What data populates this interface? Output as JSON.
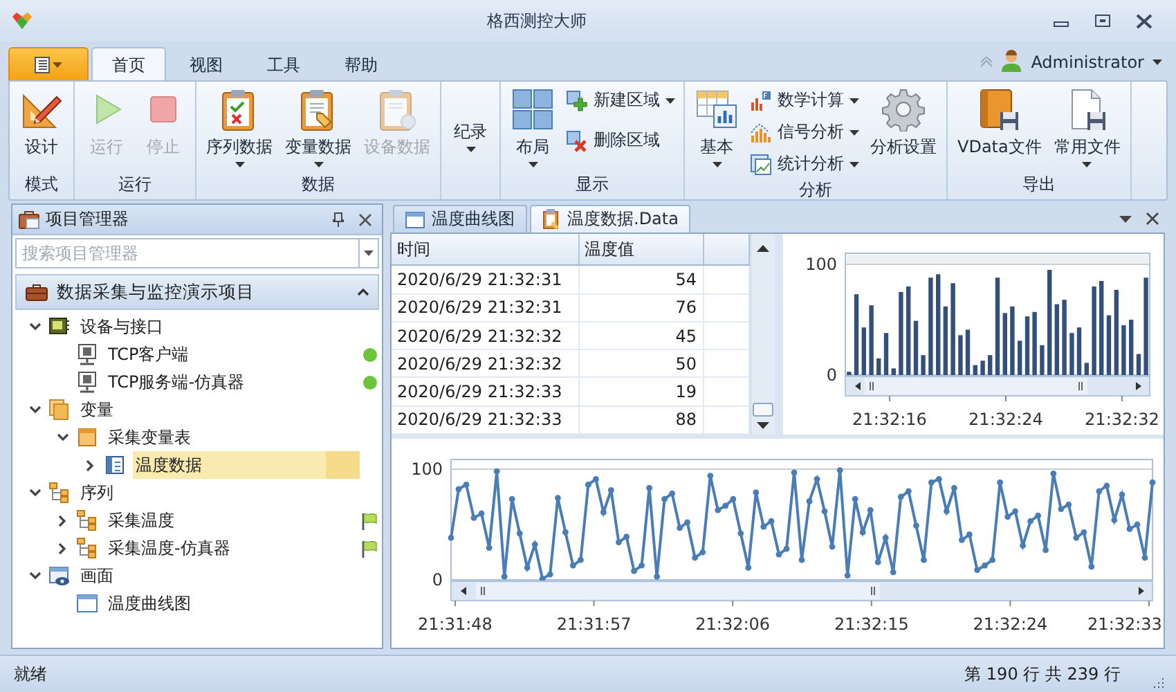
{
  "window": {
    "title": "格西测控大师"
  },
  "ribbon": {
    "tabs": [
      {
        "label": "首页",
        "selected": true
      },
      {
        "label": "视图",
        "selected": false
      },
      {
        "label": "工具",
        "selected": false
      },
      {
        "label": "帮助",
        "selected": false
      }
    ],
    "user": "Administrator",
    "groups": [
      {
        "label": "模式",
        "items": [
          {
            "label": "设计",
            "kind": "large",
            "disabled": false,
            "dropdown": false
          }
        ]
      },
      {
        "label": "运行",
        "items": [
          {
            "label": "运行",
            "kind": "large",
            "disabled": true,
            "dropdown": false
          },
          {
            "label": "停止",
            "kind": "large",
            "disabled": true,
            "dropdown": false
          }
        ]
      },
      {
        "label": "数据",
        "items": [
          {
            "label": "序列数据",
            "kind": "large",
            "disabled": false,
            "dropdown": true
          },
          {
            "label": "变量数据",
            "kind": "large",
            "disabled": false,
            "dropdown": true
          },
          {
            "label": "设备数据",
            "kind": "large",
            "disabled": true,
            "dropdown": false
          }
        ]
      },
      {
        "items": [
          {
            "label": "纪录",
            "kind": "large",
            "disabled": false,
            "dropdown": true
          }
        ]
      },
      {
        "label": "显示",
        "items": [
          {
            "label": "布局",
            "kind": "large",
            "disabled": false,
            "dropdown": true
          },
          {
            "label": "新建区域",
            "kind": "small",
            "disabled": false,
            "dropdown": true
          },
          {
            "label": "删除区域",
            "kind": "small",
            "disabled": false,
            "dropdown": false
          }
        ]
      },
      {
        "label": "分析",
        "items": [
          {
            "label": "基本",
            "kind": "large",
            "disabled": false,
            "dropdown": true
          },
          {
            "label": "数学计算",
            "kind": "small",
            "disabled": false,
            "dropdown": true
          },
          {
            "label": "信号分析",
            "kind": "small",
            "disabled": false,
            "dropdown": true
          },
          {
            "label": "统计分析",
            "kind": "small",
            "disabled": false,
            "dropdown": true
          },
          {
            "label": "分析设置",
            "kind": "large",
            "disabled": false,
            "dropdown": false
          }
        ]
      },
      {
        "label": "导出",
        "items": [
          {
            "label": "VData文件",
            "kind": "large",
            "disabled": false,
            "dropdown": false
          },
          {
            "label": "常用文件",
            "kind": "large",
            "disabled": false,
            "dropdown": true
          }
        ]
      }
    ]
  },
  "project_panel": {
    "title": "项目管理器",
    "search": {
      "placeholder": "搜索项目管理器"
    },
    "project": "数据采集与监控演示项目",
    "tree": [
      {
        "label": "设备与接口",
        "expanded": true,
        "selected": false,
        "children": [
          {
            "label": "TCP客户端",
            "selected": false,
            "color": "#6cc43a"
          },
          {
            "label": "TCP服务端-仿真器",
            "selected": false,
            "color": "#6cc43a"
          }
        ]
      },
      {
        "label": "变量",
        "expanded": true,
        "selected": false,
        "children": [
          {
            "label": "采集变量表",
            "expanded": true,
            "selected": false,
            "children": [
              {
                "label": "温度数据",
                "expanded": false,
                "selected": true
              }
            ]
          }
        ]
      },
      {
        "label": "序列",
        "expanded": true,
        "selected": false,
        "children": [
          {
            "label": "采集温度",
            "expanded": false,
            "selected": false,
            "flagged": true
          },
          {
            "label": "采集温度-仿真器",
            "expanded": false,
            "selected": false,
            "flagged": true
          }
        ]
      },
      {
        "label": "画面",
        "expanded": true,
        "selected": false,
        "children": [
          {
            "label": "温度曲线图",
            "selected": false
          }
        ]
      }
    ]
  },
  "documents": {
    "tabs": [
      {
        "label": "温度曲线图",
        "selected": false
      },
      {
        "label": "温度数据.Data",
        "selected": true
      }
    ],
    "table": {
      "columns": [
        "时间",
        "温度值"
      ],
      "rows": [
        [
          "2020/6/29 21:32:31",
          "54"
        ],
        [
          "2020/6/29 21:32:31",
          "76"
        ],
        [
          "2020/6/29 21:32:32",
          "45"
        ],
        [
          "2020/6/29 21:32:32",
          "50"
        ],
        [
          "2020/6/29 21:32:33",
          "19"
        ],
        [
          "2020/6/29 21:32:33",
          "88"
        ]
      ]
    },
    "bar_chart": {
      "time_labels": [
        "21:32:16",
        "21:32:24",
        "21:32:32"
      ],
      "chart_data": {
        "type": "bar",
        "ylim": [
          0,
          100
        ],
        "yticks": [
          0,
          100
        ],
        "values": [
          3,
          73,
          43,
          63,
          15,
          38,
          6,
          75,
          80,
          49,
          18,
          88,
          91,
          62,
          83,
          36,
          41,
          9,
          13,
          18,
          88,
          56,
          62,
          31,
          53,
          57,
          27,
          95,
          64,
          68,
          38,
          43,
          11,
          80,
          85,
          54,
          77,
          45,
          50,
          19,
          88
        ]
      }
    },
    "line_chart": {
      "time_labels": [
        "21:31:48",
        "21:31:57",
        "21:32:06",
        "21:32:15",
        "21:32:24",
        "21:32:33"
      ],
      "chart_data": {
        "type": "line",
        "marker": "circle",
        "ylim": [
          0,
          100
        ],
        "yticks": [
          0,
          100
        ],
        "values": [
          38,
          82,
          86,
          56,
          60,
          29,
          98,
          3,
          73,
          42,
          11,
          32,
          1,
          5,
          74,
          43,
          13,
          18,
          86,
          91,
          61,
          81,
          34,
          39,
          8,
          13,
          83,
          3,
          73,
          78,
          47,
          52,
          20,
          25,
          94,
          63,
          67,
          73,
          42,
          11,
          79,
          48,
          53,
          23,
          28,
          97,
          18,
          71,
          91,
          62,
          30,
          99,
          4,
          73,
          43,
          63,
          16,
          38,
          7,
          75,
          80,
          49,
          18,
          88,
          91,
          62,
          83,
          36,
          41,
          9,
          13,
          18,
          88,
          57,
          62,
          31,
          53,
          58,
          27,
          96,
          64,
          68,
          38,
          43,
          12,
          80,
          85,
          54,
          77,
          46,
          50,
          20,
          88
        ]
      }
    }
  },
  "status_bar": {
    "message": "就绪",
    "position": "第 190 行 共 239 行"
  }
}
